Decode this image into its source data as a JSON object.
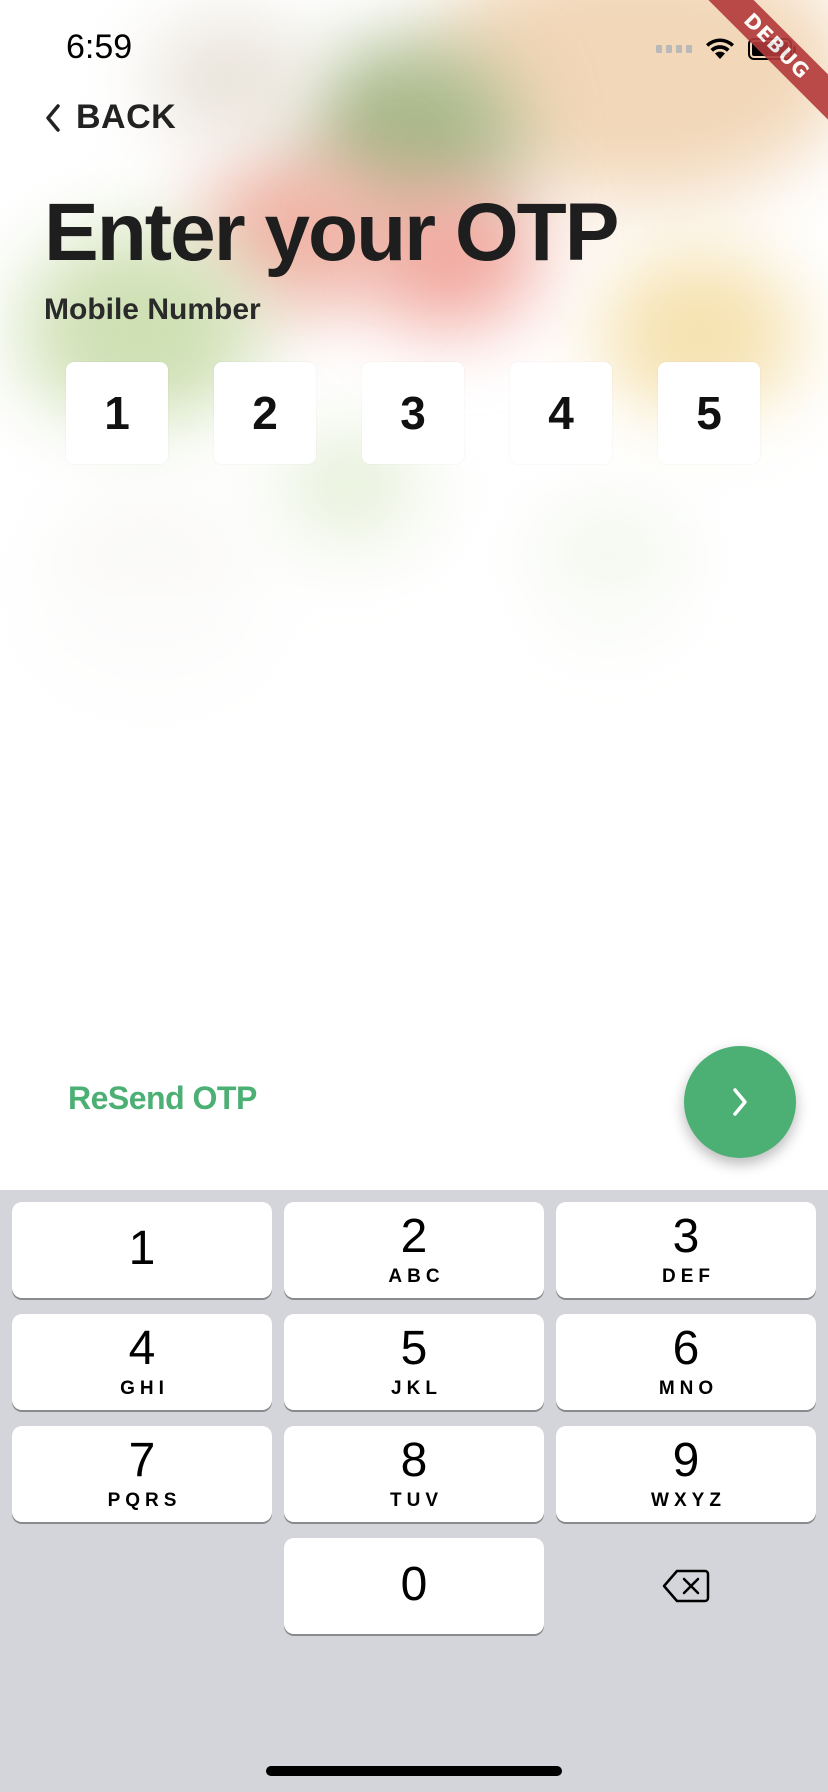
{
  "status_bar": {
    "time": "6:59"
  },
  "debug_banner": "DEBUG",
  "nav": {
    "back_label": "BACK"
  },
  "header": {
    "title": "Enter your OTP",
    "subtitle": "Mobile Number"
  },
  "otp": {
    "digits": [
      "1",
      "2",
      "3",
      "4",
      "5"
    ]
  },
  "actions": {
    "resend_label": "ReSend OTP",
    "next_icon": "chevron-right-icon"
  },
  "colors": {
    "accent": "#4caf73",
    "keyboard_bg": "#d3d5db",
    "ribbon": "#b33a3a"
  },
  "keyboard": {
    "keys": [
      {
        "digit": "1",
        "letters": ""
      },
      {
        "digit": "2",
        "letters": "ABC"
      },
      {
        "digit": "3",
        "letters": "DEF"
      },
      {
        "digit": "4",
        "letters": "GHI"
      },
      {
        "digit": "5",
        "letters": "JKL"
      },
      {
        "digit": "6",
        "letters": "MNO"
      },
      {
        "digit": "7",
        "letters": "PQRS"
      },
      {
        "digit": "8",
        "letters": "TUV"
      },
      {
        "digit": "9",
        "letters": "WXYZ"
      },
      {
        "digit": "0",
        "letters": ""
      }
    ],
    "delete_icon": "backspace-icon"
  }
}
